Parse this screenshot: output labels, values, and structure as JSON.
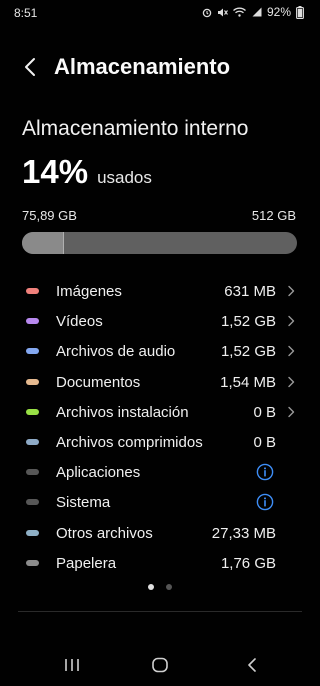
{
  "status_bar": {
    "time": "8:51",
    "battery": "92%"
  },
  "header": {
    "title": "Almacenamiento"
  },
  "summary": {
    "section_title": "Almacenamiento interno",
    "percent": "14%",
    "percent_suffix": "usados",
    "used": "75,89 GB",
    "total": "512 GB",
    "used_fraction": 0.148
  },
  "categories": [
    {
      "label": "Imágenes",
      "size": "631 MB",
      "color": "#f0817c",
      "action": "chevron"
    },
    {
      "label": "Vídeos",
      "size": "1,52 GB",
      "color": "#b889ef",
      "action": "chevron"
    },
    {
      "label": "Archivos de audio",
      "size": "1,52 GB",
      "color": "#84a8f1",
      "action": "chevron"
    },
    {
      "label": "Documentos",
      "size": "1,54 MB",
      "color": "#e5b98f",
      "action": "chevron"
    },
    {
      "label": "Archivos instalación",
      "size": "0 B",
      "color": "#98e045",
      "action": "chevron"
    },
    {
      "label": "Archivos comprimidos",
      "size": "0 B",
      "color": "#8eaac6",
      "action": "none"
    },
    {
      "label": "Aplicaciones",
      "size": "",
      "color": "#575757",
      "action": "info"
    },
    {
      "label": "Sistema",
      "size": "",
      "color": "#575757",
      "action": "info"
    },
    {
      "label": "Otros archivos",
      "size": "27,33 MB",
      "color": "#8fb0c6",
      "action": "none"
    },
    {
      "label": "Papelera",
      "size": "1,76 GB",
      "color": "#8c8c8c",
      "action": "none"
    }
  ],
  "pager": {
    "count": 2,
    "active": 0
  },
  "colors": {
    "background": "#010101",
    "info_accent": "#3e8ef7"
  }
}
